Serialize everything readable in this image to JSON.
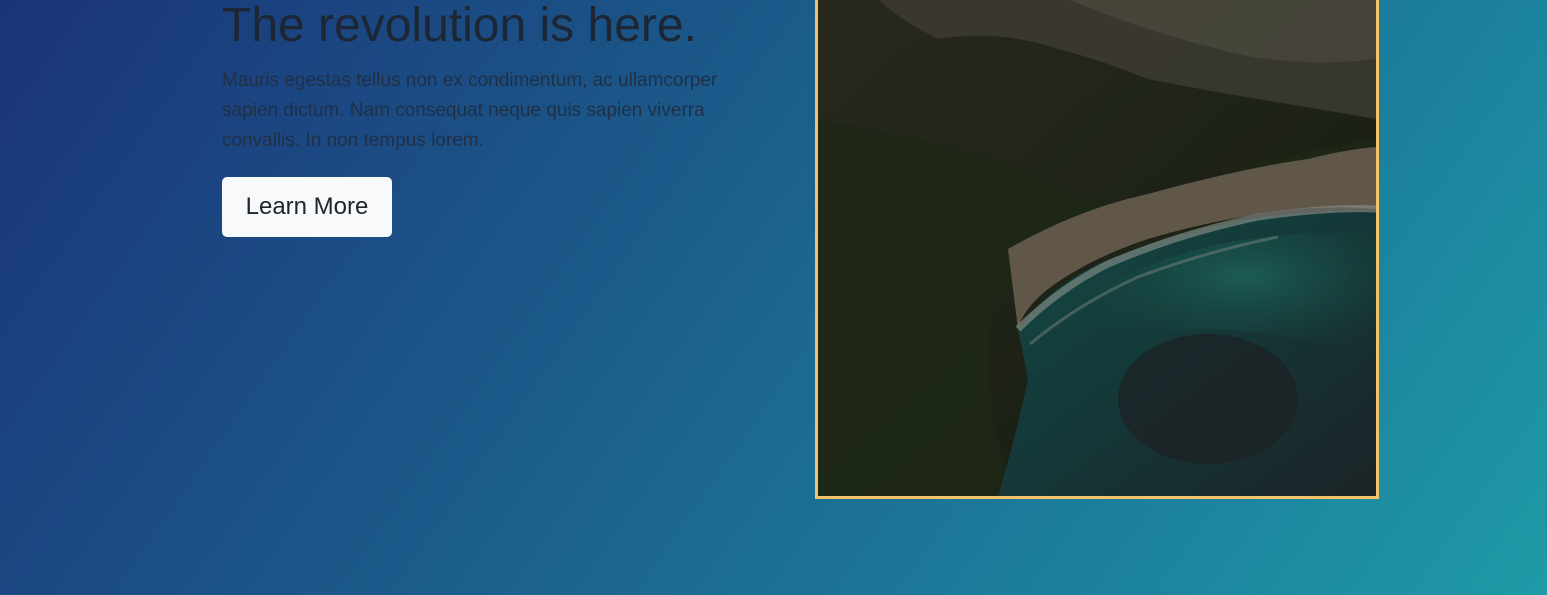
{
  "hero": {
    "heading": "The revolution is here.",
    "text": "Mauris egestas tellus non ex condimentum, ac ullamcorper sapien dictum. Nam consequat neque quis sapien viverra convallis. In non tempus lorem.",
    "button_label": "Learn More"
  },
  "colors": {
    "background_start": "#1b3479",
    "background_end": "#1e9aa6",
    "frame_border": "#f3c36b",
    "button_background": "#f8f9fb"
  }
}
